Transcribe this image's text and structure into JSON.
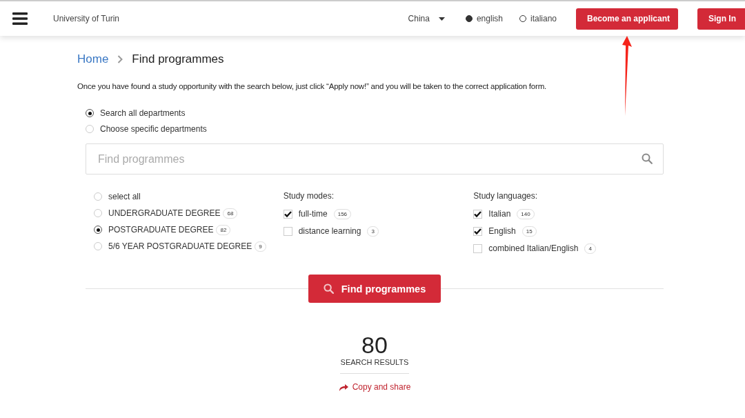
{
  "header": {
    "site_name": "University of Turin",
    "country": "China",
    "languages": [
      {
        "label": "english",
        "selected": true
      },
      {
        "label": "italiano",
        "selected": false
      }
    ],
    "buttons": [
      "Become an applicant",
      "Sign In"
    ]
  },
  "breadcrumb": [
    "Home",
    "Find programmes"
  ],
  "intro": "Once you have found a study opportunity with the search below, just click “Apply now!” and you will be taken to the correct application form.",
  "scope": [
    {
      "label": "Search all departments",
      "selected": true
    },
    {
      "label": "Choose specific departments",
      "selected": false
    }
  ],
  "search": {
    "placeholder": "Find programmes"
  },
  "degrees": [
    {
      "label": "select all",
      "selected": false
    },
    {
      "label": "UNDERGRADUATE DEGREE",
      "count": "68",
      "selected": false
    },
    {
      "label": "POSTGRADUATE DEGREE",
      "count": "82",
      "selected": true
    },
    {
      "label": "5/6 YEAR POSTGRADUATE DEGREE",
      "count": "9",
      "selected": false
    }
  ],
  "study_modes": {
    "title": "Study modes:",
    "items": [
      {
        "label": "full-time",
        "count": "156",
        "checked": true
      },
      {
        "label": "distance learning",
        "count": "3",
        "checked": false
      }
    ]
  },
  "study_languages": {
    "title": "Study languages:",
    "items": [
      {
        "label": "Italian",
        "count": "140",
        "checked": true
      },
      {
        "label": "English",
        "count": "15",
        "checked": true
      },
      {
        "label": "combined Italian/English",
        "count": "4",
        "checked": false
      }
    ]
  },
  "find_button": "Find programmes",
  "results": {
    "count": "80",
    "label": "SEARCH RESULTS",
    "share": "Copy and share"
  }
}
